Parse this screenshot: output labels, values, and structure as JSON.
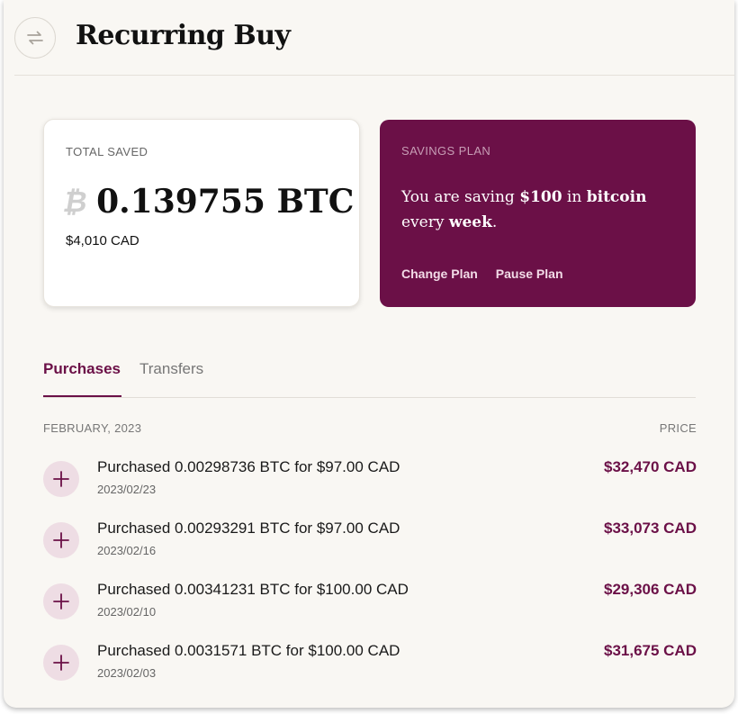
{
  "header": {
    "title": "Recurring Buy",
    "icon": "repeat-icon"
  },
  "total_saved": {
    "label": "TOTAL SAVED",
    "btc_symbol": "₿",
    "btc_amount": "0.139755 BTC",
    "cad_amount": "$4,010 CAD"
  },
  "savings_plan": {
    "label": "SAVINGS PLAN",
    "text_1": "You are saving ",
    "amount": "$100",
    "text_2": " in ",
    "asset": "bitcoin",
    "text_3": " every ",
    "frequency": "week",
    "text_4": ".",
    "change_label": "Change Plan",
    "pause_label": "Pause Plan"
  },
  "tabs": [
    {
      "label": "Purchases",
      "active": true
    },
    {
      "label": "Transfers",
      "active": false
    }
  ],
  "list": {
    "month": "FEBRUARY, 2023",
    "price_header": "PRICE",
    "items": [
      {
        "title": "Purchased 0.00298736 BTC for $97.00 CAD",
        "date": "2023/02/23",
        "price": "$32,470 CAD"
      },
      {
        "title": "Purchased 0.00293291 BTC for $97.00 CAD",
        "date": "2023/02/16",
        "price": "$33,073 CAD"
      },
      {
        "title": "Purchased 0.00341231 BTC for $100.00 CAD",
        "date": "2023/02/10",
        "price": "$29,306 CAD"
      },
      {
        "title": "Purchased 0.0031571 BTC for $100.00 CAD",
        "date": "2023/02/03",
        "price": "$31,675 CAD"
      }
    ]
  },
  "colors": {
    "brand": "#6b1047",
    "background": "#f9f7f3",
    "icon_bg": "#eedde4"
  }
}
